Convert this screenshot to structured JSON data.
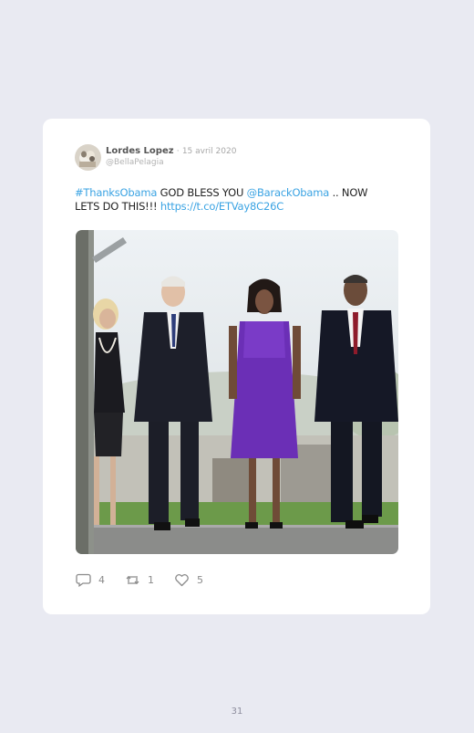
{
  "tweet": {
    "author": {
      "display_name": "Lordes Lopez",
      "separator": "·",
      "date": "15 avril 2020",
      "handle": "@BellaPelagia"
    },
    "text": {
      "hashtag": "#ThanksObama",
      "part1": " GOD BLESS YOU ",
      "mention": "@BarackObama",
      "part2": " .. NOW LETS DO THIS!!! ",
      "url": "https://t.co/ETVay8C26C"
    },
    "actions": {
      "replies": "4",
      "retweets": "1",
      "likes": "5"
    },
    "link_color": "#3aa3e3",
    "photo_icon": "photo-of-four-people-walking"
  },
  "page_number": "31"
}
